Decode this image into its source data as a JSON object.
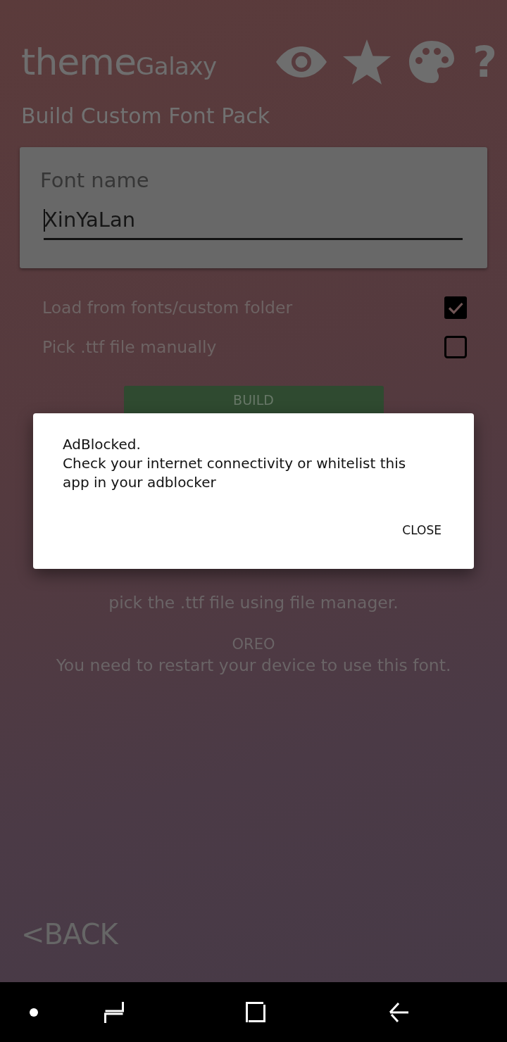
{
  "header": {
    "logo_main": "theme",
    "logo_sub": "Galaxy",
    "help_label": "?",
    "subtitle": "Build Custom Font Pack"
  },
  "font_field": {
    "label": "Font name",
    "value": "XinYaLan"
  },
  "options": [
    {
      "label": "Load from fonts/custom folder",
      "checked": true
    },
    {
      "label": "Pick .ttf file manually",
      "checked": false
    }
  ],
  "build_button": {
    "label": "BUILD"
  },
  "instructions": {
    "tail": "pick the .ttf file using file manager.",
    "oreo_heading": "OREO",
    "oreo_text": "You need to restart your device to use this font."
  },
  "back_link": {
    "label": "<BACK"
  },
  "dialog": {
    "title": "AdBlocked.",
    "message": "Check your internet connectivity or whitelist this app in your adblocker",
    "buttons": [
      "CLOSE"
    ]
  }
}
